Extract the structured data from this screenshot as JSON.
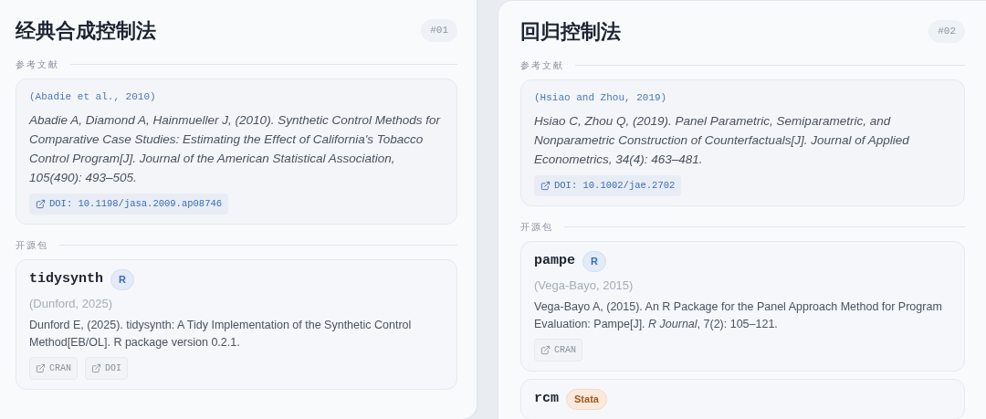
{
  "methods": [
    {
      "title": "经典合成控制法",
      "number": "#01",
      "references_label": "参考文献",
      "reference": {
        "citation": "(Abadie et al., 2010)",
        "text": "Abadie A, Diamond A, Hainmueller J, (2010). Synthetic Control Methods for Comparative Case Studies: Estimating the Effect of California's Tobacco Control Program[J]. Journal of the American Statistical Association, 105(490): 493–505.",
        "doi": "DOI: 10.1198/jasa.2009.ap08746"
      },
      "packages_label": "开源包",
      "packages": [
        {
          "name": "tidysynth",
          "language": {
            "label": "R",
            "kind": "r"
          },
          "citation": "(Dunford, 2025)",
          "description": "Dunford E, (2025). tidysynth: A Tidy Implementation of the Synthetic Control Method[EB/OL]. R package version 0.2.1.",
          "links": [
            "CRAN",
            "DOI"
          ]
        }
      ]
    },
    {
      "title": "回归控制法",
      "number": "#02",
      "references_label": "参考文献",
      "reference": {
        "citation": "(Hsiao and Zhou, 2019)",
        "text": "Hsiao C, Zhou Q, (2019). Panel Parametric, Semiparametric, and Nonparametric Construction of Counterfactuals[J]. Journal of Applied Econometrics, 34(4): 463–481.",
        "doi": "DOI: 10.1002/jae.2702"
      },
      "packages_label": "开源包",
      "packages": [
        {
          "name": "pampe",
          "language": {
            "label": "R",
            "kind": "r"
          },
          "citation": "(Vega-Bayo, 2015)",
          "description": "Vega-Bayo A, (2015). An R Package for the Panel Approach Method for Program Evaluation: Pampe[J]. *R Journal*, 7(2): 105–121.",
          "links": [
            "CRAN"
          ]
        },
        {
          "name": "rcm",
          "language": {
            "label": "Stata",
            "kind": "stata"
          }
        }
      ]
    }
  ]
}
